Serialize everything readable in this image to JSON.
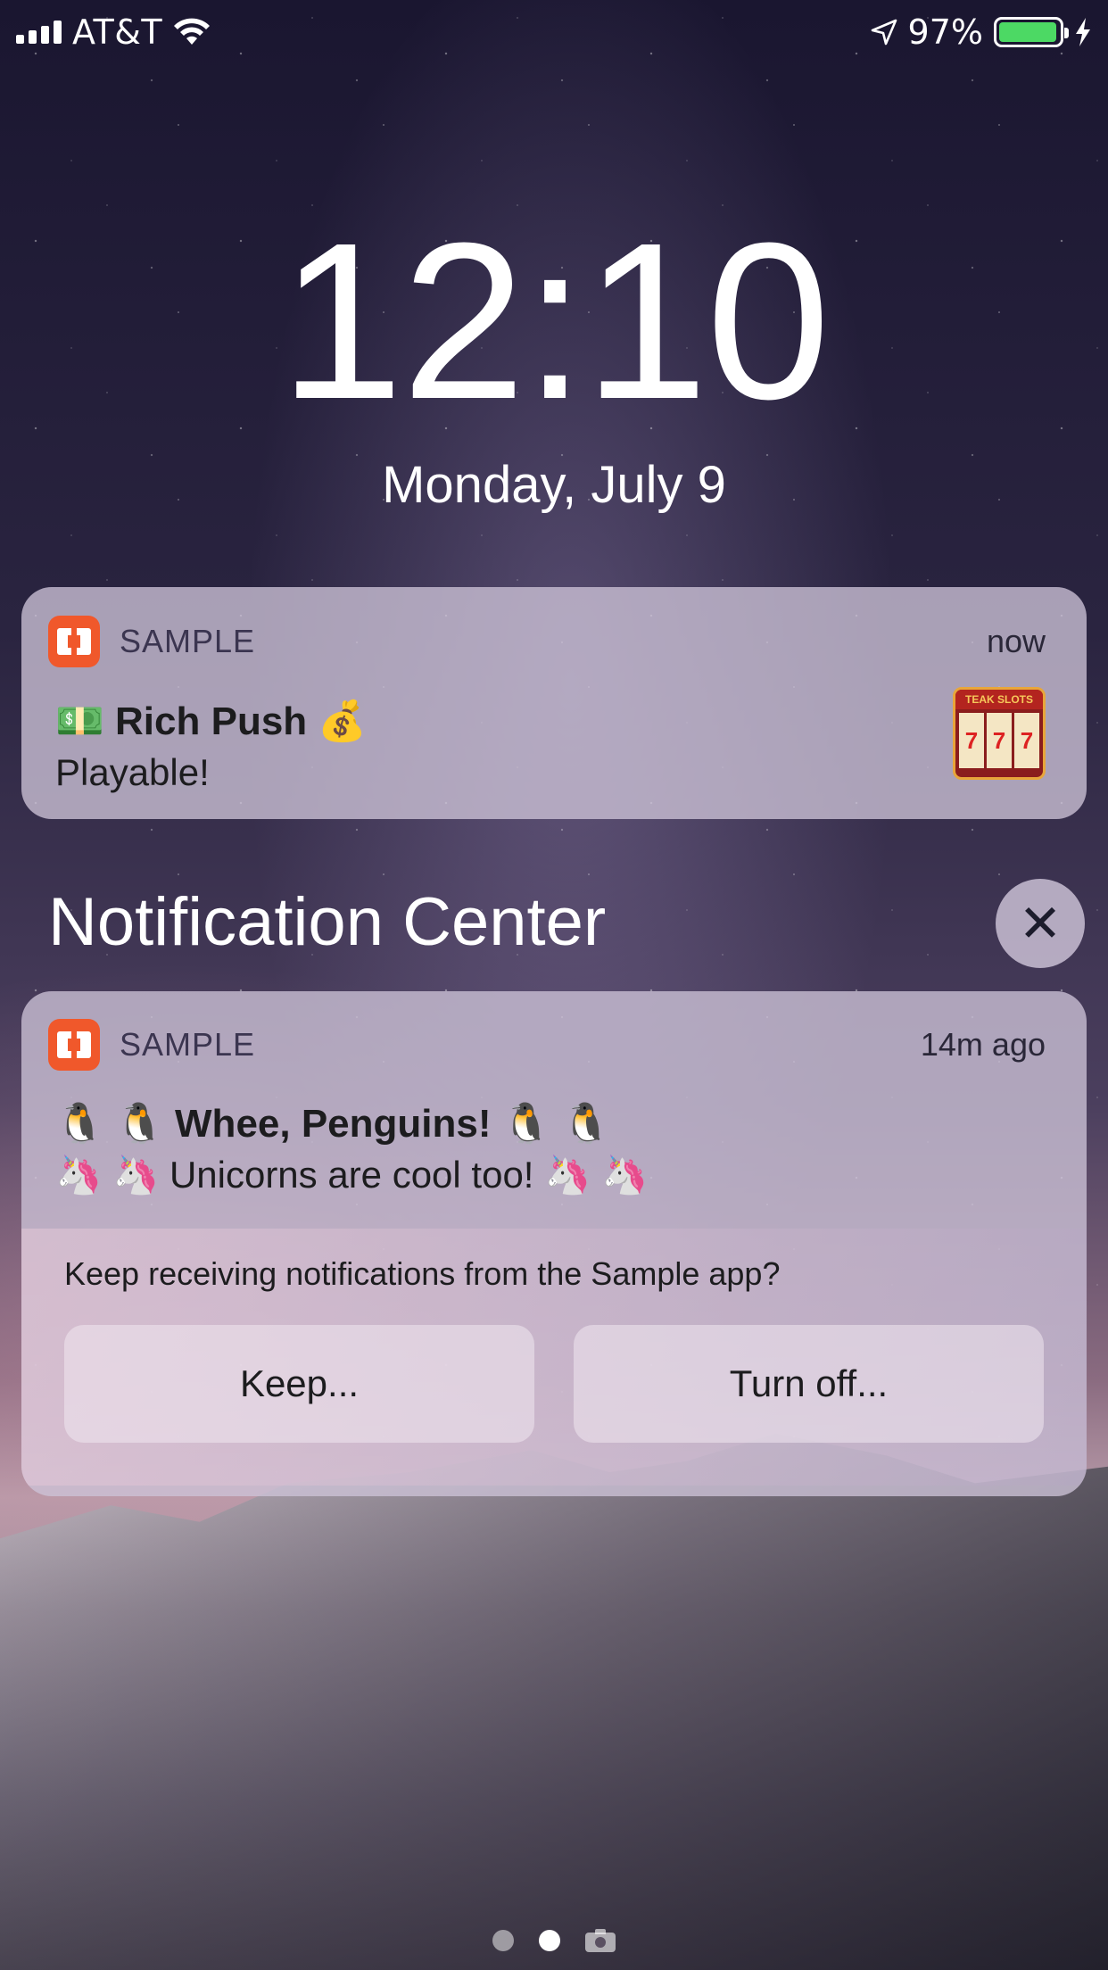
{
  "status_bar": {
    "carrier": "AT&T",
    "battery_percent": "97%",
    "battery_level": 0.97,
    "icons": [
      "signal-icon",
      "wifi-icon",
      "location-icon",
      "battery-icon",
      "charging-icon"
    ]
  },
  "lock_screen": {
    "time": "12:10",
    "date": "Monday, July 9"
  },
  "notification_1": {
    "app_name": "SAMPLE",
    "timestamp": "now",
    "title_emoji_left": "💵",
    "title": "Rich Push",
    "title_emoji_right": "💰",
    "body": "Playable!",
    "thumbnail_label": "TEAK SLOTS",
    "thumbnail_reels": [
      "7",
      "7",
      "7"
    ]
  },
  "notification_center": {
    "title": "Notification Center",
    "close_label": "✕"
  },
  "notification_2": {
    "app_name": "SAMPLE",
    "timestamp": "14m ago",
    "title_emoji_left": "🐧 🐧",
    "title": "Whee, Penguins!",
    "title_emoji_right": "🐧 🐧",
    "body_emoji_left": "🦄 🦄",
    "body": "Unicorns are cool too!",
    "body_emoji_right": "🦄 🦄",
    "prompt": "Keep receiving notifications from the Sample app?",
    "keep_label": "Keep...",
    "turn_off_label": "Turn off..."
  },
  "colors": {
    "app_icon": "#f0582b",
    "battery_fill": "#4cd964"
  }
}
